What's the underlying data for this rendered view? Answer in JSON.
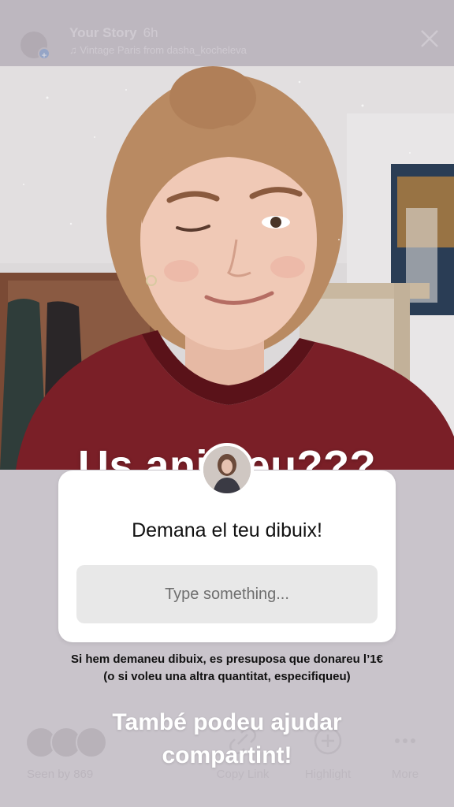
{
  "header": {
    "title": "Your Story",
    "age": "6h",
    "subtitle": "Vintage Paris from dasha_kocheleva"
  },
  "photo": {
    "caption": "Us animeu???"
  },
  "question_sticker": {
    "prompt": "Demana el teu dibuix!",
    "input_placeholder": "Type something..."
  },
  "note": "Si hem demaneu dibuix, es presuposa que donareu l’1€ (o si voleu una altra quantitat, especifiqueu)",
  "share_text": "També podeu ajudar compartint!",
  "footer": {
    "seen_label": "Seen by 869",
    "actions": [
      {
        "label": "Copy Link",
        "icon": "link-icon"
      },
      {
        "label": "Highlight",
        "icon": "highlight-icon"
      },
      {
        "label": "More",
        "icon": "more-icon"
      }
    ]
  },
  "colors": {
    "background": "#c9c4cb",
    "card": "#ffffff",
    "input": "#e8e8e8",
    "shirt": "#7a1f27"
  }
}
